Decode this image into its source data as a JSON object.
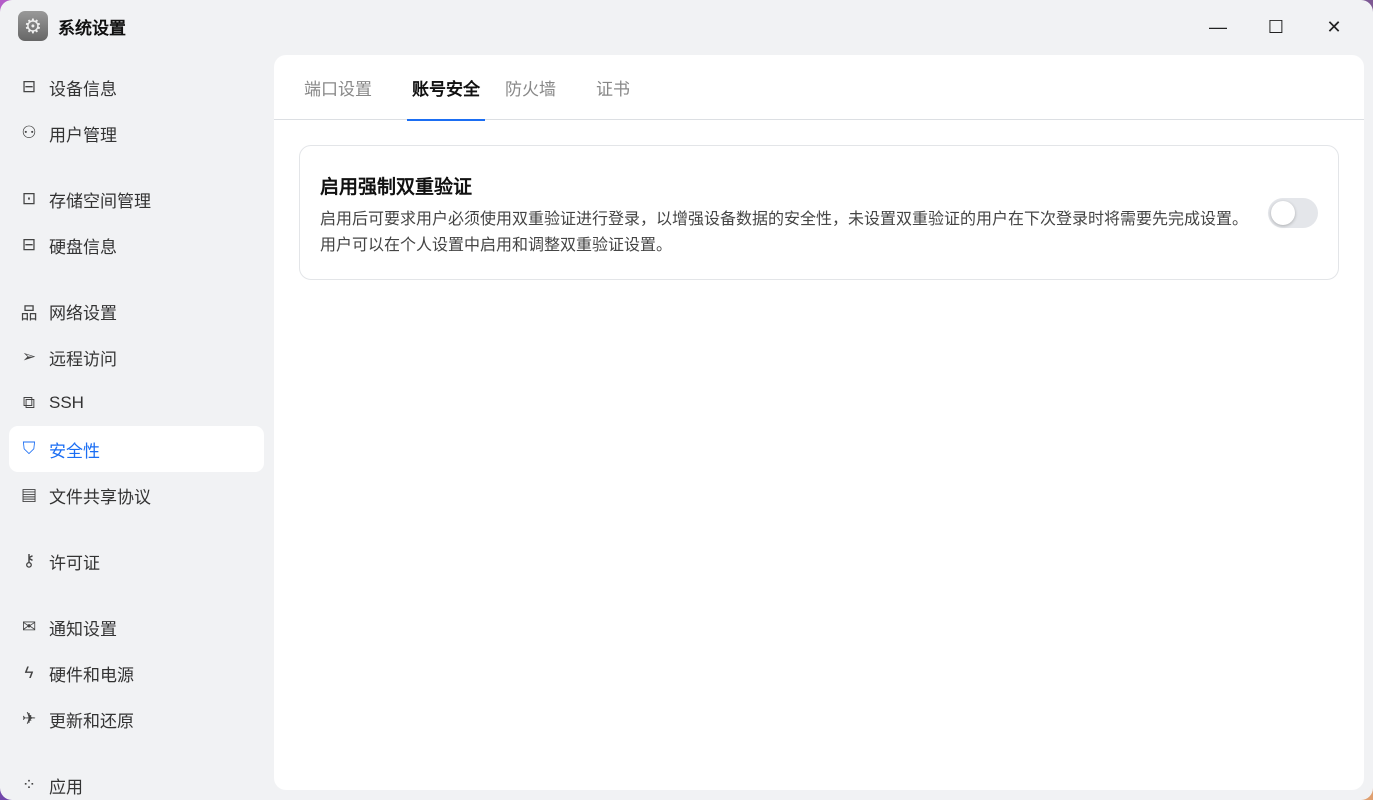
{
  "window": {
    "title": "系统设置",
    "minimize": "—",
    "maximize": "☐",
    "close": "✕"
  },
  "sidebar": {
    "items": [
      {
        "label": "设备信息",
        "icon": "drive-icon",
        "glyph": "⊟"
      },
      {
        "label": "用户管理",
        "icon": "user-gear-icon",
        "glyph": "⚇"
      },
      {
        "label": "存储空间管理",
        "icon": "inbox-icon",
        "glyph": "⊡"
      },
      {
        "label": "硬盘信息",
        "icon": "drive-icon",
        "glyph": "⊟"
      },
      {
        "label": "网络设置",
        "icon": "network-icon",
        "glyph": "品"
      },
      {
        "label": "远程访问",
        "icon": "send-icon",
        "glyph": "➢"
      },
      {
        "label": "SSH",
        "icon": "code-icon",
        "glyph": "⧉"
      },
      {
        "label": "安全性",
        "icon": "shield-check-icon",
        "glyph": "⛉"
      },
      {
        "label": "文件共享协议",
        "icon": "document-icon",
        "glyph": "▤"
      },
      {
        "label": "许可证",
        "icon": "key-icon",
        "glyph": "⚷"
      },
      {
        "label": "通知设置",
        "icon": "mail-icon",
        "glyph": "✉"
      },
      {
        "label": "硬件和电源",
        "icon": "power-icon",
        "glyph": "ϟ"
      },
      {
        "label": "更新和还原",
        "icon": "rocket-icon",
        "glyph": "✈"
      },
      {
        "label": "应用",
        "icon": "apps-icon",
        "glyph": "⁘"
      }
    ]
  },
  "tabs": [
    "端口设置",
    "账号安全",
    "防火墙",
    "证书"
  ],
  "card": {
    "title": "启用强制双重验证",
    "description": "启用后可要求用户必须使用双重验证进行登录，以增强设备数据的安全性，未设置双重验证的用户在下次登录时将需要先完成设置。用户可以在个人设置中启用和调整双重验证设置。",
    "toggle_on": false
  },
  "accent": "#1b6ef3"
}
